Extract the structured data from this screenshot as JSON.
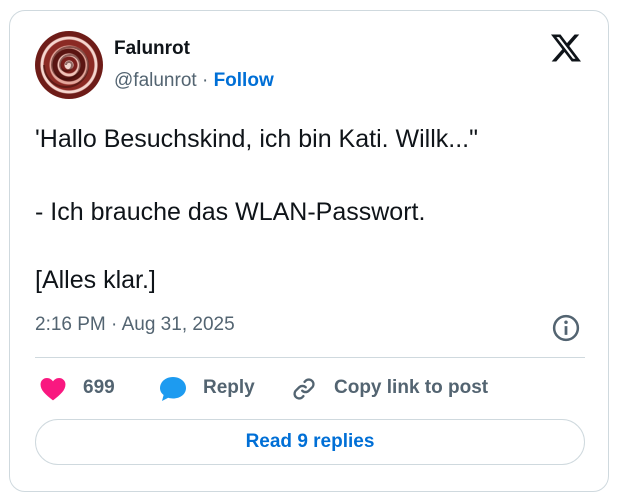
{
  "author": {
    "name": "Falunrot",
    "handle": "@falunrot",
    "separator": " · ",
    "follow_label": "Follow"
  },
  "tweet": {
    "lines": [
      "'Hallo Besuchskind, ich bin Kati. Willk...\"",
      "- Ich brauche das WLAN-Passwort.",
      "[Alles klar.]"
    ],
    "timestamp": "2:16 PM · Aug 31, 2025"
  },
  "actions": {
    "likes_count": "699",
    "reply_label": "Reply",
    "copy_link_label": "Copy link to post",
    "read_replies_label": "Read 9 replies"
  },
  "icons": {
    "logo": "x-logo-icon",
    "info": "info-icon",
    "like": "heart-icon",
    "reply": "speech-bubble-icon",
    "link": "link-icon"
  },
  "colors": {
    "heart": "#f91880",
    "reply": "#1d9bf0",
    "link_accent": "#006fd6",
    "muted": "#536471",
    "text": "#0f1419",
    "border": "#cfd9de"
  }
}
